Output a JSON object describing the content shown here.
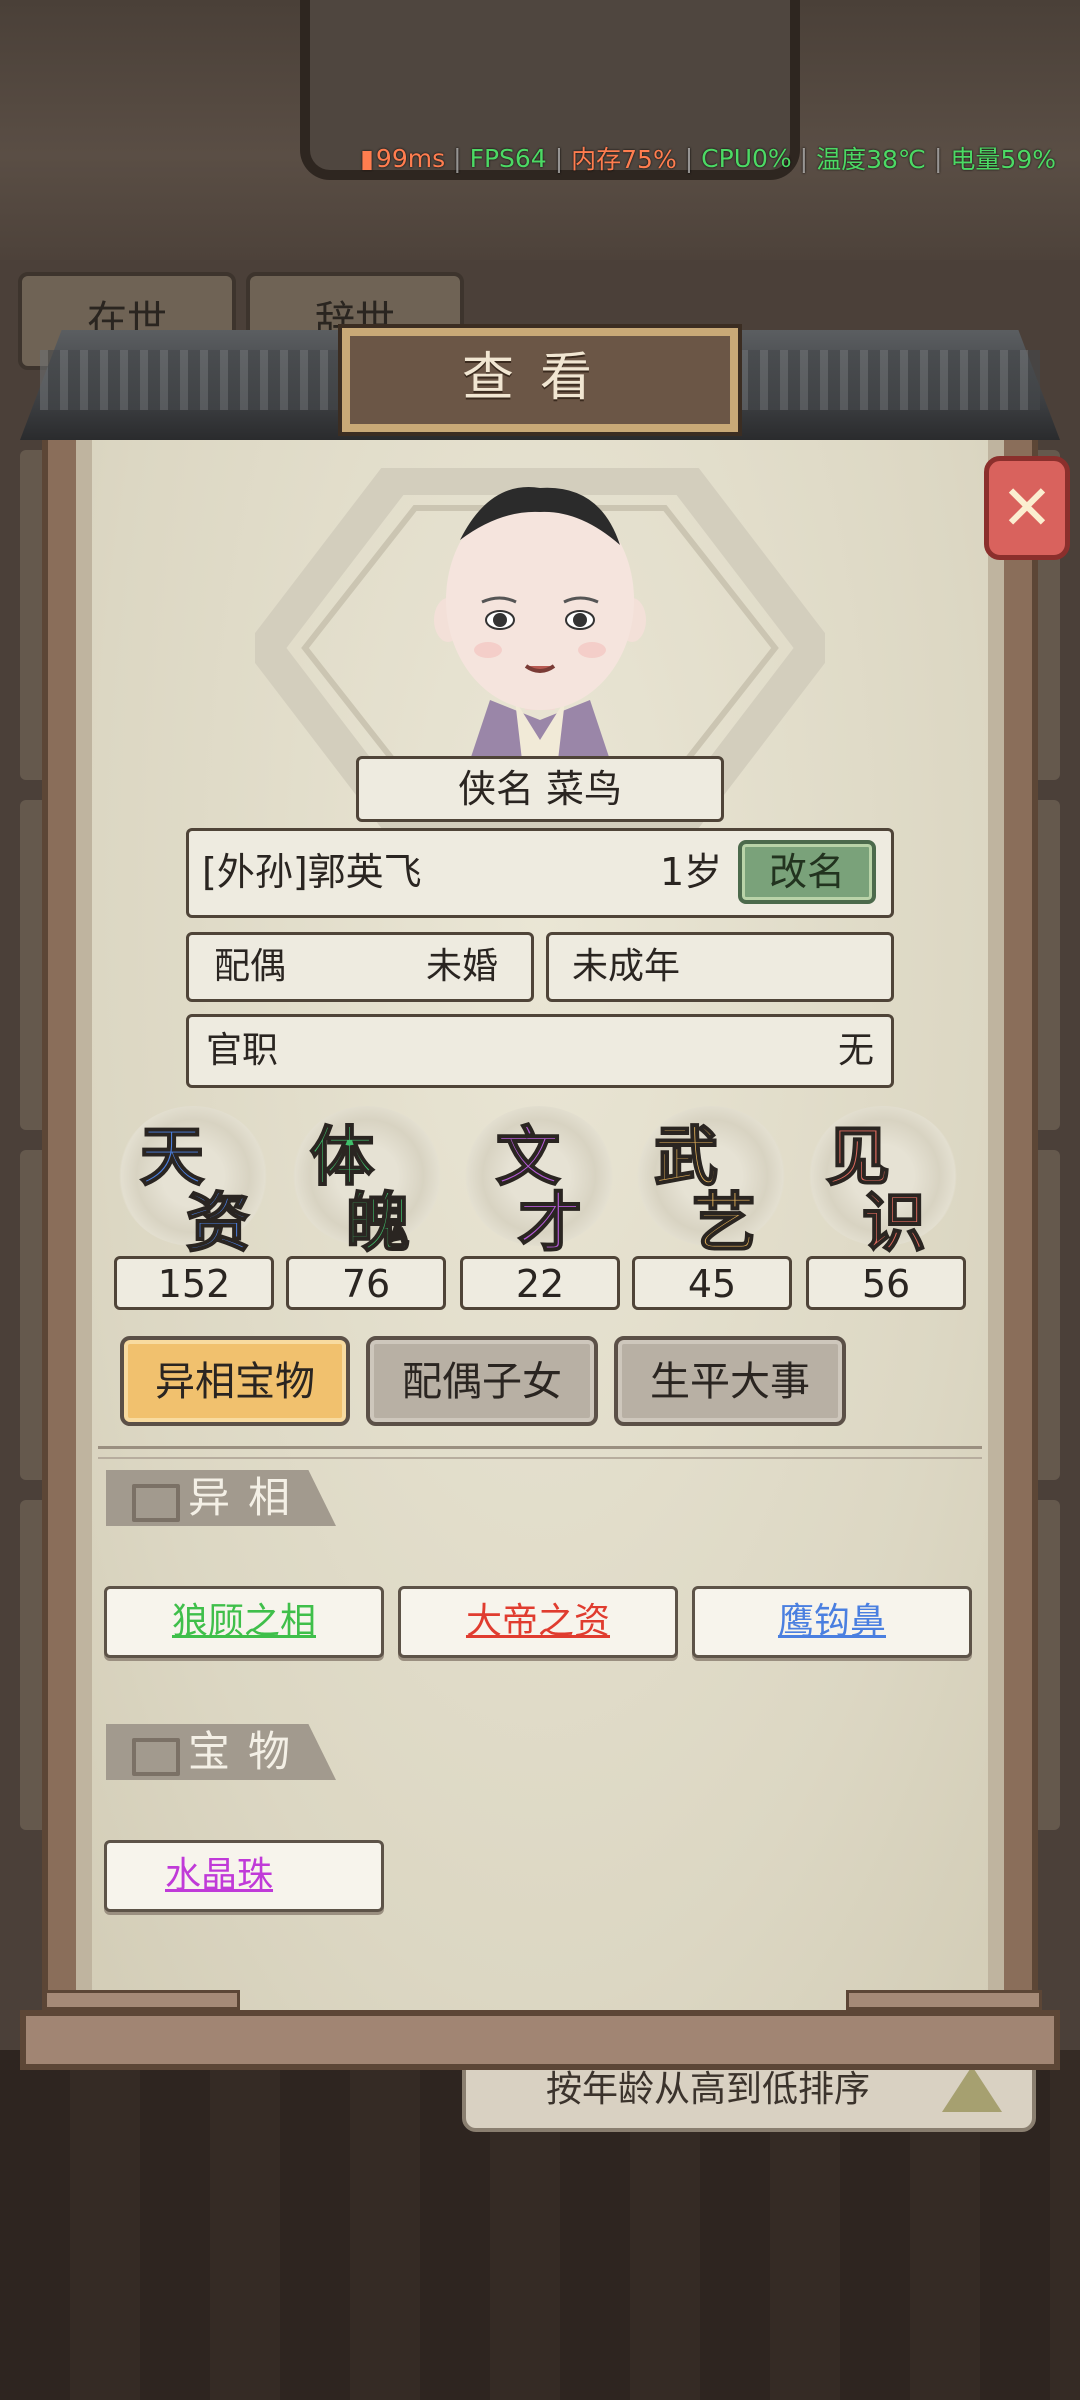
{
  "status_bar": {
    "ping": "99ms",
    "fps": "FPS64",
    "memory": "内存75%",
    "cpu": "CPU0%",
    "temperature": "温度38℃",
    "battery": "电量59%"
  },
  "background": {
    "tab_alive": "在世",
    "tab_dead": "辞世",
    "sort_label": "按年龄从高到低排序"
  },
  "dialog": {
    "title": "查看",
    "close_icon": "close-icon"
  },
  "character": {
    "nickname": "侠名 菜鸟",
    "name": "[外孙]郭英飞",
    "age": "1岁",
    "rename_label": "改名",
    "spouse_label": "配偶",
    "spouse_value": "未婚",
    "adult_status": "未成年",
    "office_label": "官职",
    "office_value": "无"
  },
  "stats": [
    {
      "top": "天",
      "bottom": "资",
      "value": "152",
      "color": "#4a7fe0"
    },
    {
      "top": "体",
      "bottom": "魄",
      "value": "76",
      "color": "#3fbf6b"
    },
    {
      "top": "文",
      "bottom": "才",
      "value": "22",
      "color": "#b55ad8"
    },
    {
      "top": "武",
      "bottom": "艺",
      "value": "45",
      "color": "#e8b45a"
    },
    {
      "top": "见",
      "bottom": "识",
      "value": "56",
      "color": "#e26b5f"
    }
  ],
  "tabs": [
    {
      "label": "异相宝物",
      "active": true
    },
    {
      "label": "配偶子女",
      "active": false
    },
    {
      "label": "生平大事",
      "active": false
    }
  ],
  "sections": {
    "traits_title": "异相",
    "traits": [
      {
        "label": "狼顾之相",
        "color": "#3fbf4a"
      },
      {
        "label": "大帝之资",
        "color": "#e03c2f"
      },
      {
        "label": "鹰钩鼻",
        "color": "#4a7fe0"
      }
    ],
    "treasures_title": "宝物",
    "treasures": [
      {
        "label": "水晶珠",
        "color": "#c03ad8"
      }
    ]
  }
}
